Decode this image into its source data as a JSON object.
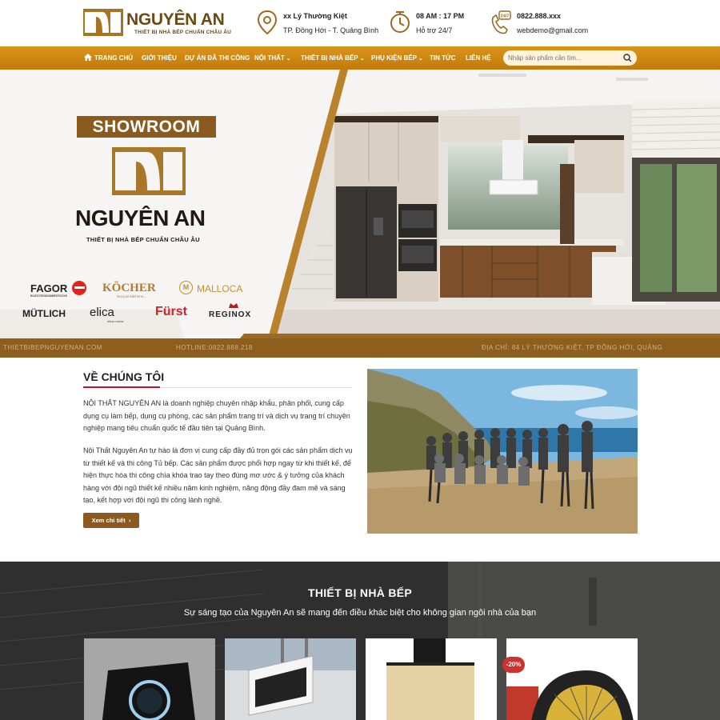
{
  "brand": {
    "name": "NGUYÊN AN",
    "tagline": "THIẾT BỊ NHÀ BẾP CHUẨN CHÂU ÂU"
  },
  "header_info": [
    {
      "icon": "location-pin-icon",
      "line1": "xx Lý Thường Kiệt",
      "line2": "TP. Đồng Hới - T. Quảng Bình"
    },
    {
      "icon": "clock-icon",
      "line1": "08 AM : 17 PM",
      "line2": "Hỗ trợ 24/7"
    },
    {
      "icon": "phone-24-7-icon",
      "line1": "0822.888.xxx",
      "line2": "webdemo@gmail.com"
    }
  ],
  "nav": {
    "items": [
      {
        "label": "TRANG CHỦ",
        "icon": "home-icon",
        "dropdown": false
      },
      {
        "label": "GIỚI THIỆU",
        "dropdown": false
      },
      {
        "label": "DỰ ÁN ĐÃ THI CÔNG",
        "dropdown": false
      },
      {
        "label": "NỘI THẤT",
        "dropdown": true
      },
      {
        "label": "THIẾT BỊ NHÀ BẾP",
        "dropdown": true
      },
      {
        "label": "PHỤ KIỆN BẾP",
        "dropdown": true
      },
      {
        "label": "TIN TỨC",
        "dropdown": false
      },
      {
        "label": "LIÊN HỆ",
        "dropdown": false
      }
    ],
    "search_placeholder": "Nhập sản phẩm cần tìm..."
  },
  "banner": {
    "showroom_label": "SHOWROOM",
    "brand_name": "NGUYÊN AN",
    "brand_tagline": "THIẾT BỊ NHÀ BẾP CHUẨN CHÂU ÂU",
    "partner_brands": [
      "FAGOR",
      "KÖCHER",
      "MALLOCA",
      "MÜTLICH",
      "elica",
      "Fürst",
      "REGINOX"
    ],
    "partner_subtexts": {
      "fagor": "ELECTRODOMESTICOS",
      "kocher": "Not just kitchens...",
      "elica": "elica nuova"
    },
    "strip": {
      "website": "THIETBIBEPNGUYENAN.COM",
      "hotline": "HOTLINE:0822.888.218",
      "address": "ĐỊA CHỈ: 84 LÝ THƯỜNG KIỆT, TP ĐỒNG HỚI, QUẢNG"
    }
  },
  "about": {
    "title": "VỀ CHÚNG TÔI",
    "paragraph1": "NỘI THẤT NGUYÊN AN là doanh nghiệp chuyên nhập khẩu, phân phối, cung cấp dụng cụ làm bếp, dụng cụ phòng, các sản phẩm trang trí và dịch vụ trang trí chuyên nghiệp mang tiêu chuẩn quốc tế đầu tiên tại Quảng Bình.",
    "paragraph2": "Nội Thất Nguyên An tự hào là đơn vị cung cấp đầy đủ trọn gói các sản phẩm dịch vụ từ thiết kế và thi công Tủ bếp. Các sản phẩm được phối hợp ngay từ khi thiết kế, để hiện thực hóa thi công chìa khóa trao tay theo đúng mơ ước & ý tưởng của khách hàng với đội ngũ thiết kế nhiều năm kinh nghiệm, năng động đầy đam mê và sáng tạo, kết hợp với đội ngũ thi công lành nghề.",
    "button_label": "Xem chi tiết"
  },
  "products": {
    "title": "THIẾT BỊ NHÀ BẾP",
    "subtitle": "Sự sáng tạo của Nguyên An sẽ mang đến điều khác biệt cho không gian ngôi nhà của bạn",
    "sale_badge": "-20%"
  },
  "colors": {
    "accent": "#c8851a",
    "brown": "#8b5a1e",
    "underline": "#c8102e",
    "sale": "#d0312d"
  }
}
